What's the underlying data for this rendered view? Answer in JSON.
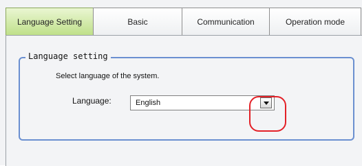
{
  "tabs": [
    {
      "label": "Language Setting",
      "active": true
    },
    {
      "label": "Basic",
      "active": false
    },
    {
      "label": "Communication",
      "active": false
    },
    {
      "label": "Operation mode",
      "active": false
    }
  ],
  "group": {
    "title": "Language setting",
    "description": "Select language of the system.",
    "language_label": "Language:",
    "language_value": "English"
  },
  "colors": {
    "active_tab": "#bfe08a",
    "group_border": "#6a8fd0",
    "highlight": "#e32027"
  }
}
